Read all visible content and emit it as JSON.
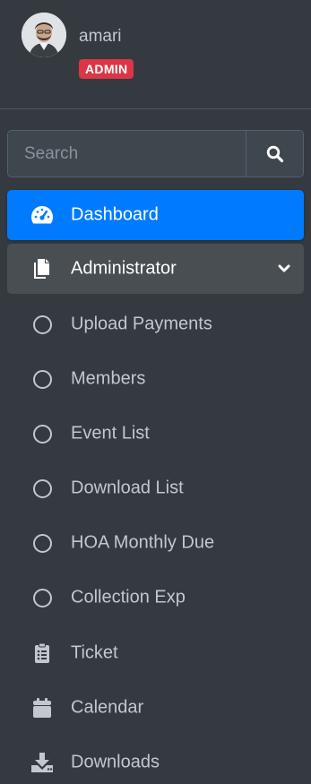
{
  "user": {
    "name": "amari",
    "role": "ADMIN"
  },
  "search": {
    "placeholder": "Search",
    "value": ""
  },
  "colors": {
    "sidebar_bg": "#343a40",
    "active_bg": "#007bff",
    "open_bg": "#494e53",
    "badge_bg": "#dc3545",
    "text": "#c2c7d0"
  },
  "nav": {
    "dashboard": {
      "label": "Dashboard",
      "icon": "tachometer-icon"
    },
    "administrator": {
      "label": "Administrator",
      "icon": "copy-icon"
    },
    "admin_items": [
      {
        "label": "Upload Payments",
        "icon": "circle-icon"
      },
      {
        "label": "Members",
        "icon": "circle-icon"
      },
      {
        "label": "Event List",
        "icon": "circle-icon"
      },
      {
        "label": "Download List",
        "icon": "circle-icon"
      },
      {
        "label": "HOA Monthly Due",
        "icon": "circle-icon"
      },
      {
        "label": "Collection Exp",
        "icon": "circle-icon"
      }
    ],
    "ticket": {
      "label": "Ticket",
      "icon": "clipboard-list-icon"
    },
    "calendar": {
      "label": "Calendar",
      "icon": "calendar-icon"
    },
    "downloads": {
      "label": "Downloads",
      "icon": "download-icon"
    }
  }
}
